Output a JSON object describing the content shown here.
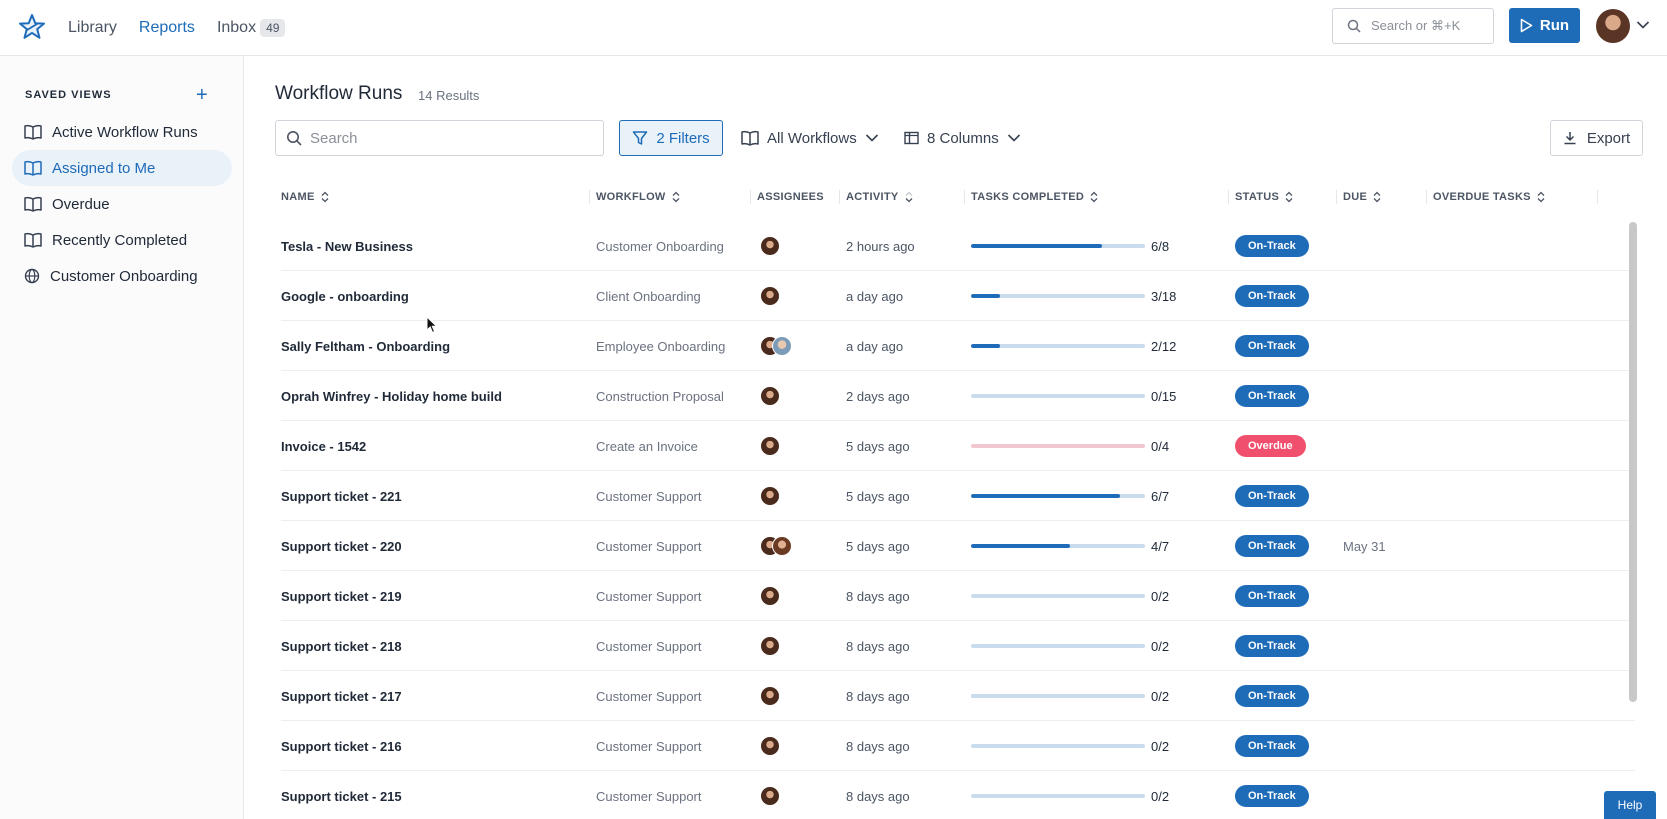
{
  "nav": {
    "items": [
      {
        "label": "Library"
      },
      {
        "label": "Reports"
      },
      {
        "label": "Inbox",
        "badge": "49"
      }
    ]
  },
  "top_search": {
    "placeholder": "Search or ⌘+K"
  },
  "run_button": {
    "label": "Run"
  },
  "sidebar": {
    "title": "SAVED VIEWS",
    "items": [
      {
        "label": "Active Workflow Runs",
        "icon": "book-icon"
      },
      {
        "label": "Assigned to Me",
        "icon": "book-icon",
        "active": true
      },
      {
        "label": "Overdue",
        "icon": "book-icon"
      },
      {
        "label": "Recently Completed",
        "icon": "book-icon"
      },
      {
        "label": "Customer Onboarding",
        "icon": "globe-icon"
      }
    ]
  },
  "main": {
    "title": "Workflow Runs",
    "results": "14 Results",
    "search_placeholder": "Search",
    "filters_label": "2 Filters",
    "workflows_label": "All Workflows",
    "columns_label": "8 Columns",
    "export_label": "Export"
  },
  "table": {
    "headers": [
      "NAME",
      "WORKFLOW",
      "ASSIGNEES",
      "ACTIVITY",
      "TASKS COMPLETED",
      "STATUS",
      "DUE",
      "OVERDUE TASKS"
    ],
    "rows": [
      {
        "name": "Tesla - New Business",
        "workflow": "Customer Onboarding",
        "activity": "2 hours ago",
        "tasks": "6/8",
        "progress": 0.75,
        "status": "On-Track",
        "due": "",
        "assignees": 1
      },
      {
        "name": "Google - onboarding",
        "workflow": "Client Onboarding",
        "activity": "a day ago",
        "tasks": "3/18",
        "progress": 0.1667,
        "status": "On-Track",
        "due": "",
        "assignees": 1
      },
      {
        "name": "Sally Feltham - Onboarding",
        "workflow": "Employee Onboarding",
        "activity": "a day ago",
        "tasks": "2/12",
        "progress": 0.1667,
        "status": "On-Track",
        "due": "",
        "assignees": 2
      },
      {
        "name": "Oprah Winfrey - Holiday home build",
        "workflow": "Construction Proposal",
        "activity": "2 days ago",
        "tasks": "0/15",
        "progress": 0,
        "status": "On-Track",
        "due": "",
        "assignees": 1
      },
      {
        "name": "Invoice - 1542",
        "workflow": "Create an Invoice",
        "activity": "5 days ago",
        "tasks": "0/4",
        "progress": 0,
        "status": "Overdue",
        "due": "",
        "assignees": 1
      },
      {
        "name": "Support ticket - 221",
        "workflow": "Customer Support",
        "activity": "5 days ago",
        "tasks": "6/7",
        "progress": 0.857,
        "status": "On-Track",
        "due": "",
        "assignees": 1
      },
      {
        "name": "Support ticket - 220",
        "workflow": "Customer Support",
        "activity": "5 days ago",
        "tasks": "4/7",
        "progress": 0.571,
        "status": "On-Track",
        "due": "May 31",
        "assignees": 2
      },
      {
        "name": "Support ticket - 219",
        "workflow": "Customer Support",
        "activity": "8 days ago",
        "tasks": "0/2",
        "progress": 0,
        "status": "On-Track",
        "due": "",
        "assignees": 1
      },
      {
        "name": "Support ticket - 218",
        "workflow": "Customer Support",
        "activity": "8 days ago",
        "tasks": "0/2",
        "progress": 0,
        "status": "On-Track",
        "due": "",
        "assignees": 1
      },
      {
        "name": "Support ticket - 217",
        "workflow": "Customer Support",
        "activity": "8 days ago",
        "tasks": "0/2",
        "progress": 0,
        "status": "On-Track",
        "due": "",
        "assignees": 1
      },
      {
        "name": "Support ticket - 216",
        "workflow": "Customer Support",
        "activity": "8 days ago",
        "tasks": "0/2",
        "progress": 0,
        "status": "On-Track",
        "due": "",
        "assignees": 1
      },
      {
        "name": "Support ticket - 215",
        "workflow": "Customer Support",
        "activity": "8 days ago",
        "tasks": "0/2",
        "progress": 0,
        "status": "On-Track",
        "due": "",
        "assignees": 1
      }
    ]
  },
  "help_label": "Help",
  "colors": {
    "accent": "#1e6bb8",
    "overdue": "#f0506e",
    "track": "#c9dcee"
  }
}
